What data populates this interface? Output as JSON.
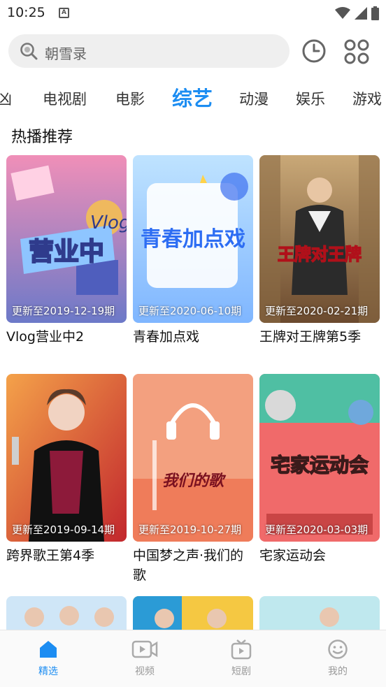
{
  "status_bar": {
    "time": "10:25",
    "notification_letter": "A"
  },
  "search": {
    "placeholder": "朝雪录"
  },
  "tabs": [
    {
      "label": "凶"
    },
    {
      "label": "电视剧"
    },
    {
      "label": "电影"
    },
    {
      "label": "综艺",
      "active": true
    },
    {
      "label": "动漫"
    },
    {
      "label": "娱乐"
    },
    {
      "label": "游戏"
    }
  ],
  "section_title": "热播推荐",
  "cards": [
    {
      "title": "Vlog营业中2",
      "update": "更新至2019-12-19期",
      "poster_text": "营业中"
    },
    {
      "title": "青春加点戏",
      "update": "更新至2020-06-10期",
      "poster_text": "青春加点戏"
    },
    {
      "title": "王牌对王牌第5季",
      "update": "更新至2020-02-21期",
      "poster_text": "王牌对王牌"
    },
    {
      "title": "跨界歌王第4季",
      "update": "更新至2019-09-14期",
      "poster_text": ""
    },
    {
      "title": "中国梦之声·我们的歌",
      "update": "更新至2019-10-27期",
      "poster_text": "我们的歌"
    },
    {
      "title": "宅家运动会",
      "update": "更新至2020-03-03期",
      "poster_text": "宅家运动会"
    }
  ],
  "bottom_nav": [
    {
      "label": "精选",
      "icon": "home-icon",
      "active": true
    },
    {
      "label": "视频",
      "icon": "video-icon"
    },
    {
      "label": "短剧",
      "icon": "tv-icon"
    },
    {
      "label": "我的",
      "icon": "smile-icon"
    }
  ],
  "colors": {
    "accent": "#1c8df2",
    "search_bg": "#efefef"
  }
}
